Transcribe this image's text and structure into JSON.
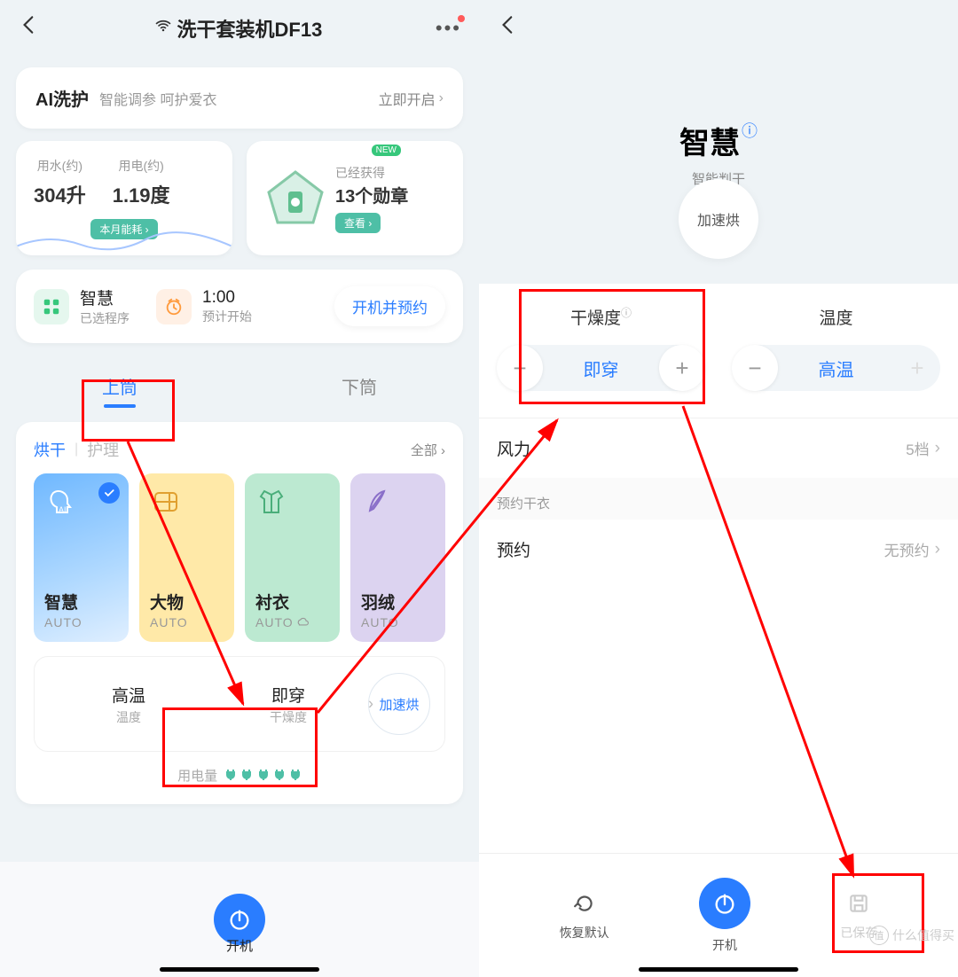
{
  "left": {
    "header": {
      "title": "洗干套装机DF13"
    },
    "ai": {
      "title": "AI洗护",
      "subtitle": "智能调参 呵护爱衣",
      "action": "立即开启"
    },
    "stats": {
      "water_label": "用水(约)",
      "water_value": "304升",
      "power_label": "用电(约)",
      "power_value": "1.19度",
      "tag": "本月能耗"
    },
    "badges": {
      "new": "NEW",
      "label": "已经获得",
      "value": "13个勋章",
      "view": "查看"
    },
    "schedule": {
      "prog_name": "智慧",
      "prog_sub": "已选程序",
      "time": "1:00",
      "time_sub": "预计开始",
      "button": "开机并预约"
    },
    "drum_tabs": {
      "upper": "上筒",
      "lower": "下筒"
    },
    "panel": {
      "cat_active": "烘干",
      "cat_inactive": "护理",
      "all": "全部",
      "programs": [
        {
          "name": "智慧",
          "auto": "AUTO"
        },
        {
          "name": "大物",
          "auto": "AUTO"
        },
        {
          "name": "衬衣",
          "auto": "AUTO"
        },
        {
          "name": "羽绒",
          "auto": "AUTO"
        }
      ],
      "opts": {
        "temp_value": "高温",
        "temp_label": "温度",
        "dry_value": "即穿",
        "dry_label": "干燥度",
        "chip": "加速烘"
      },
      "power_label": "用电量"
    },
    "bottom": {
      "power": "开机"
    }
  },
  "right": {
    "title": "智慧",
    "subtitle": "智能判干",
    "chip": "加速烘",
    "dryness": {
      "label": "干燥度",
      "value": "即穿"
    },
    "temp": {
      "label": "温度",
      "value": "高温"
    },
    "wind_section": "风力",
    "wind_value": "5档",
    "reserve_section": "预约干衣",
    "reserve_label": "预约",
    "reserve_value": "无预约",
    "bottom": {
      "reset": "恢复默认",
      "power": "开机",
      "save": "已保存"
    }
  },
  "watermark": {
    "icon": "值",
    "text": "什么值得买"
  }
}
